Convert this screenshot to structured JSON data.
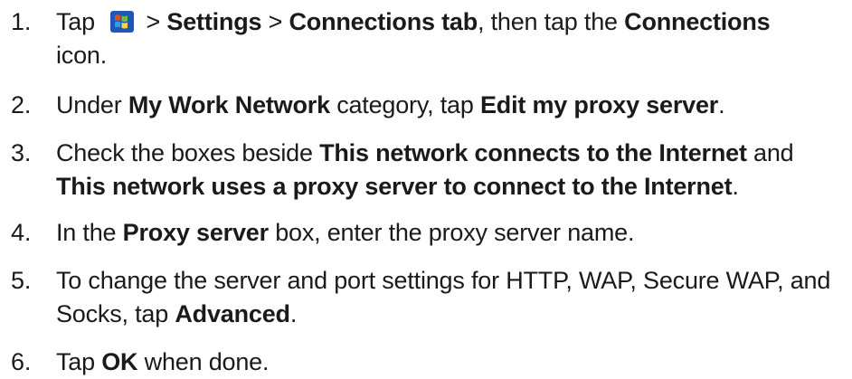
{
  "steps": [
    {
      "number": "1.",
      "parts": {
        "a": "Tap ",
        "b": " > ",
        "c": "Settings",
        "d": " > ",
        "e": "Connections tab",
        "f": ", then tap the ",
        "g": "Connections",
        "h": " icon."
      }
    },
    {
      "number": "2.",
      "parts": {
        "a": "Under ",
        "b": "My Work Network",
        "c": " category, tap ",
        "d": "Edit my proxy server",
        "e": "."
      }
    },
    {
      "number": "3.",
      "parts": {
        "a": "Check the boxes beside ",
        "b": "This network connects to the Internet",
        "c": " and ",
        "d": "This network uses a proxy server to connect to the Internet",
        "e": "."
      }
    },
    {
      "number": "4.",
      "parts": {
        "a": "In the ",
        "b": "Proxy server",
        "c": " box, enter the proxy server name."
      }
    },
    {
      "number": "5.",
      "parts": {
        "a": "To change the server and port settings for HTTP, WAP, Secure WAP, and Socks, tap ",
        "b": "Advanced",
        "c": "."
      }
    },
    {
      "number": "6.",
      "parts": {
        "a": "Tap ",
        "b": "OK",
        "c": " when done."
      }
    }
  ],
  "icons": {
    "start": "windows-start-icon"
  }
}
